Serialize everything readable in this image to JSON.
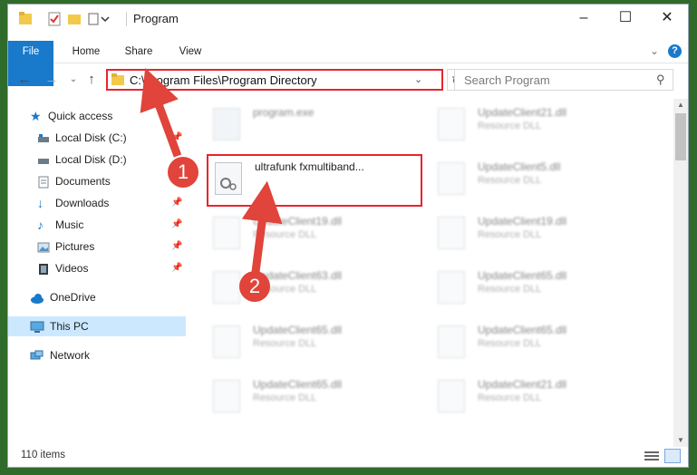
{
  "window": {
    "title": "Program",
    "minimize_icon": "minimize-icon",
    "maximize_icon": "maximize-icon",
    "close_icon": "close-icon"
  },
  "ribbon": {
    "tabs": [
      "File",
      "Home",
      "Share",
      "View"
    ]
  },
  "address": {
    "path": "C:\\Program Files\\Program Directory"
  },
  "search": {
    "placeholder": "Search Program"
  },
  "sidebar": {
    "items": [
      {
        "label": "Quick access",
        "icon": "star-icon"
      },
      {
        "label": "Local Disk (C:)",
        "icon": "drive-icon"
      },
      {
        "label": "Local Disk (D:)",
        "icon": "drive-icon"
      },
      {
        "label": "Documents",
        "icon": "documents-icon"
      },
      {
        "label": "Downloads",
        "icon": "downloads-icon"
      },
      {
        "label": "Music",
        "icon": "music-icon"
      },
      {
        "label": "Pictures",
        "icon": "pictures-icon"
      },
      {
        "label": "Videos",
        "icon": "videos-icon"
      },
      {
        "label": "OneDrive",
        "icon": "cloud-icon"
      },
      {
        "label": "This PC",
        "icon": "computer-icon"
      },
      {
        "label": "Network",
        "icon": "network-icon"
      }
    ]
  },
  "files": {
    "left": [
      {
        "name": "program.exe",
        "desc": ""
      },
      {
        "name": "ultrafunk fxmultiband...",
        "desc": ""
      },
      {
        "name": "UpdateClient19.dll",
        "desc": "Resource DLL"
      },
      {
        "name": "UpdateClient63.dll",
        "desc": "Resource DLL"
      },
      {
        "name": "UpdateClient65.dll",
        "desc": "Resource DLL"
      },
      {
        "name": "UpdateClient65.dll",
        "desc": "Resource DLL"
      }
    ],
    "right": [
      {
        "name": "UpdateClient21.dll",
        "desc": "Resource DLL"
      },
      {
        "name": "UpdateClient5.dll",
        "desc": "Resource DLL"
      },
      {
        "name": "UpdateClient19.dll",
        "desc": "Resource DLL"
      },
      {
        "name": "UpdateClient65.dll",
        "desc": "Resource DLL"
      },
      {
        "name": "UpdateClient65.dll",
        "desc": "Resource DLL"
      },
      {
        "name": "UpdateClient21.dll",
        "desc": "Resource DLL"
      }
    ]
  },
  "status": {
    "count": "110 items"
  },
  "annotations": {
    "step1": "1",
    "step2": "2"
  },
  "colors": {
    "accent": "#1979ca",
    "highlight_red": "#e8242d",
    "badge_red": "#e0443a"
  }
}
